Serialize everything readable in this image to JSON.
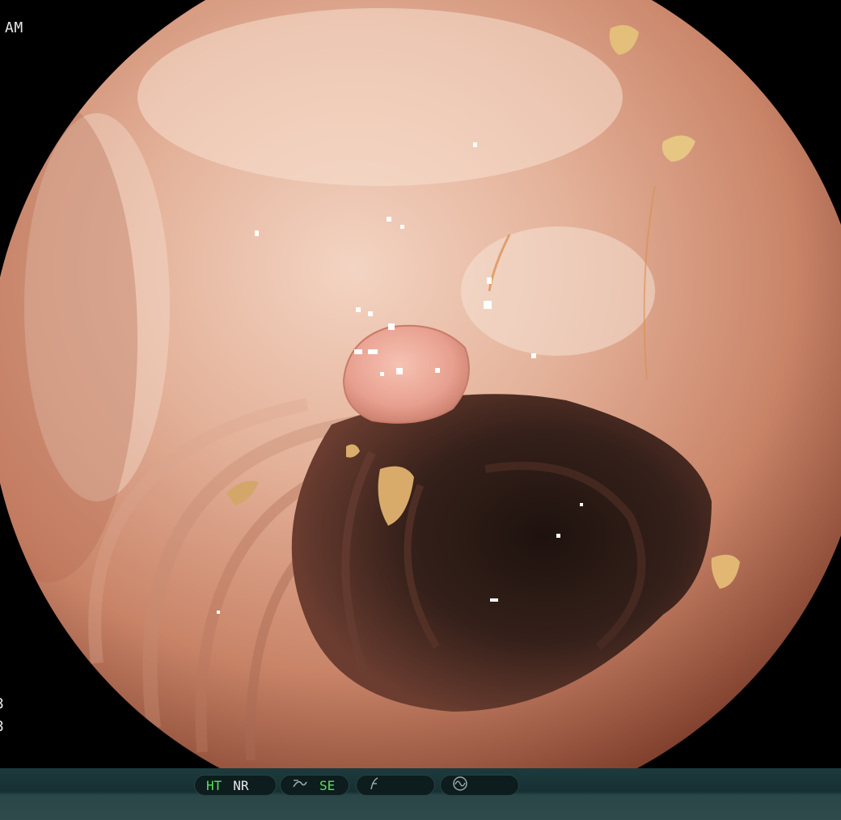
{
  "overlay": {
    "top_left": "AM",
    "left_marks": [
      "3",
      "3"
    ]
  },
  "status_bar": {
    "group1": {
      "items": [
        {
          "label": "HT",
          "active": true
        },
        {
          "label": "NR",
          "active": false
        }
      ]
    },
    "group2": {
      "icon": "enhancement-curve-icon",
      "items": [
        {
          "label": "SE",
          "active": true
        }
      ]
    },
    "group3": {
      "icon": "freeze-f-icon"
    },
    "group4": {
      "icon": "waveform-circle-icon"
    }
  },
  "colors": {
    "active_green": "#57e05a",
    "mucosa": "#d8a48c",
    "lumen_dark": "#2b1a15",
    "bar": "#1d3a3c"
  }
}
